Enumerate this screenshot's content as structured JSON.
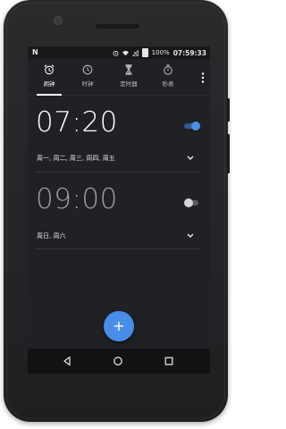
{
  "statusbar": {
    "notification": "N",
    "battery_percent": "100%",
    "time": "07:59:33"
  },
  "tabs": [
    {
      "label": "闹钟",
      "icon": "alarm-clock-icon",
      "active": true
    },
    {
      "label": "时钟",
      "icon": "clock-icon",
      "active": false
    },
    {
      "label": "定时器",
      "icon": "hourglass-icon",
      "active": false
    },
    {
      "label": "秒表",
      "icon": "stopwatch-icon",
      "active": false
    }
  ],
  "alarms": [
    {
      "time": "07:20",
      "days": "周一, 周二, 周三, 周四, 周五",
      "enabled": true
    },
    {
      "time": "09:00",
      "days": "周日, 周六",
      "enabled": false
    }
  ],
  "fab": {
    "label": "+"
  },
  "colors": {
    "accent": "#4a8de8",
    "background": "#202124",
    "statusbar": "#17181a",
    "navbar": "#111214"
  }
}
